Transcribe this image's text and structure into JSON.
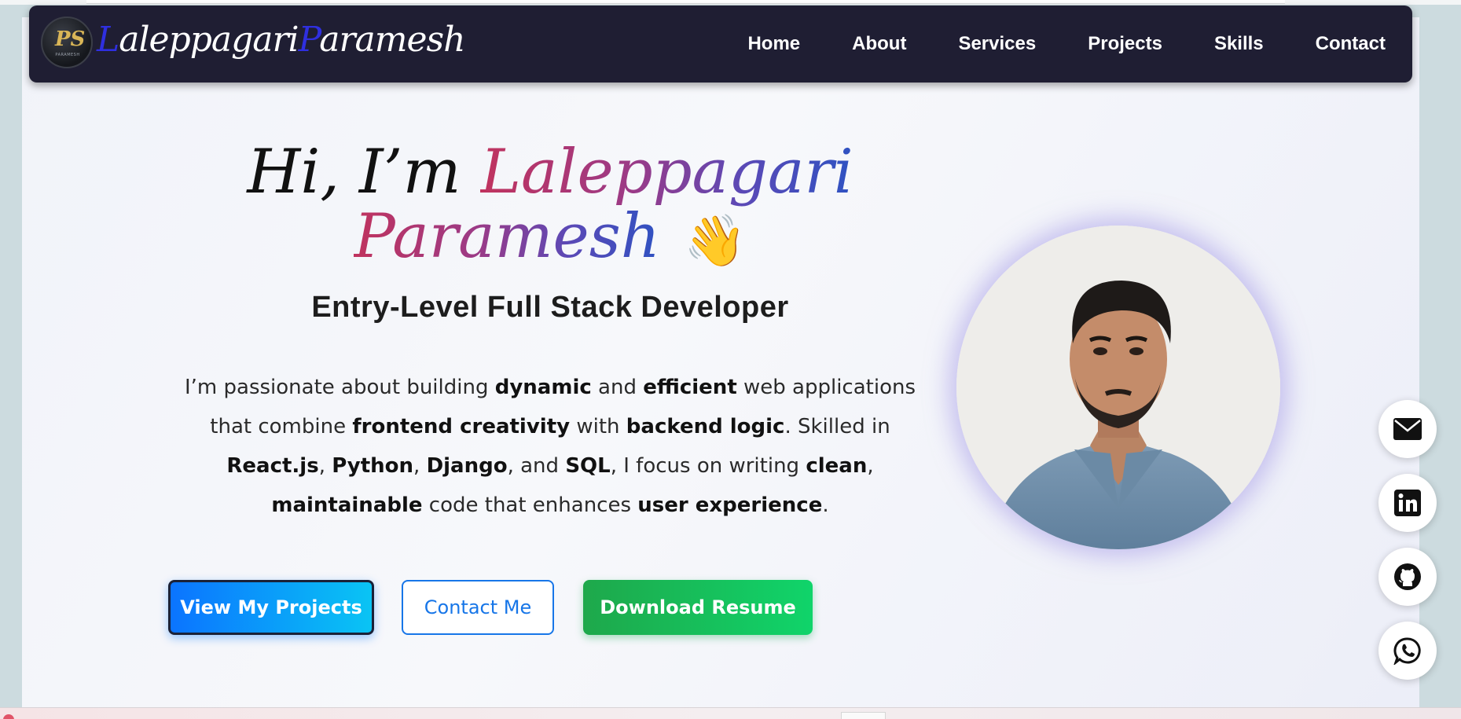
{
  "brand": {
    "name_first": "Laleppagari",
    "name_last": "Paramesh",
    "logo_monogram": "PS",
    "logo_subtext": "PARAMESH"
  },
  "nav": {
    "items": [
      "Home",
      "About",
      "Services",
      "Projects",
      "Skills",
      "Contact"
    ]
  },
  "hero": {
    "greeting": "Hi, I’m",
    "name_line1": "Laleppagari",
    "name_line2": "Paramesh",
    "wave_emoji": "👋",
    "role": "Entry-Level Full Stack Developer",
    "bio": [
      {
        "t": "I’m passionate about building ",
        "b": false
      },
      {
        "t": "dynamic",
        "b": true
      },
      {
        "t": " and ",
        "b": false
      },
      {
        "t": "efficient",
        "b": true
      },
      {
        "t": " web applications that combine ",
        "b": false
      },
      {
        "t": "frontend creativity",
        "b": true
      },
      {
        "t": " with ",
        "b": false
      },
      {
        "t": "backend logic",
        "b": true
      },
      {
        "t": ". Skilled in ",
        "b": false
      },
      {
        "t": "React.js",
        "b": true
      },
      {
        "t": ", ",
        "b": false
      },
      {
        "t": "Python",
        "b": true
      },
      {
        "t": ", ",
        "b": false
      },
      {
        "t": "Django",
        "b": true
      },
      {
        "t": ", and ",
        "b": false
      },
      {
        "t": "SQL",
        "b": true
      },
      {
        "t": ", I focus on writing ",
        "b": false
      },
      {
        "t": "clean",
        "b": true
      },
      {
        "t": ", ",
        "b": false
      },
      {
        "t": "maintainable",
        "b": true
      },
      {
        "t": " code that enhances ",
        "b": false
      },
      {
        "t": "user experience",
        "b": true
      },
      {
        "t": ".",
        "b": false
      }
    ],
    "buttons": {
      "projects": "View My Projects",
      "contact": "Contact Me",
      "resume": "Download Resume"
    }
  },
  "social": [
    "email-icon",
    "linkedin-icon",
    "github-icon",
    "whatsapp-icon"
  ],
  "colors": {
    "nav_bg": "#1f1e33",
    "brand_accent": "#2f2fe0",
    "primary_blue": "#0b74ff",
    "contact_blue": "#1776e8",
    "resume_green": "#1ea84b"
  }
}
